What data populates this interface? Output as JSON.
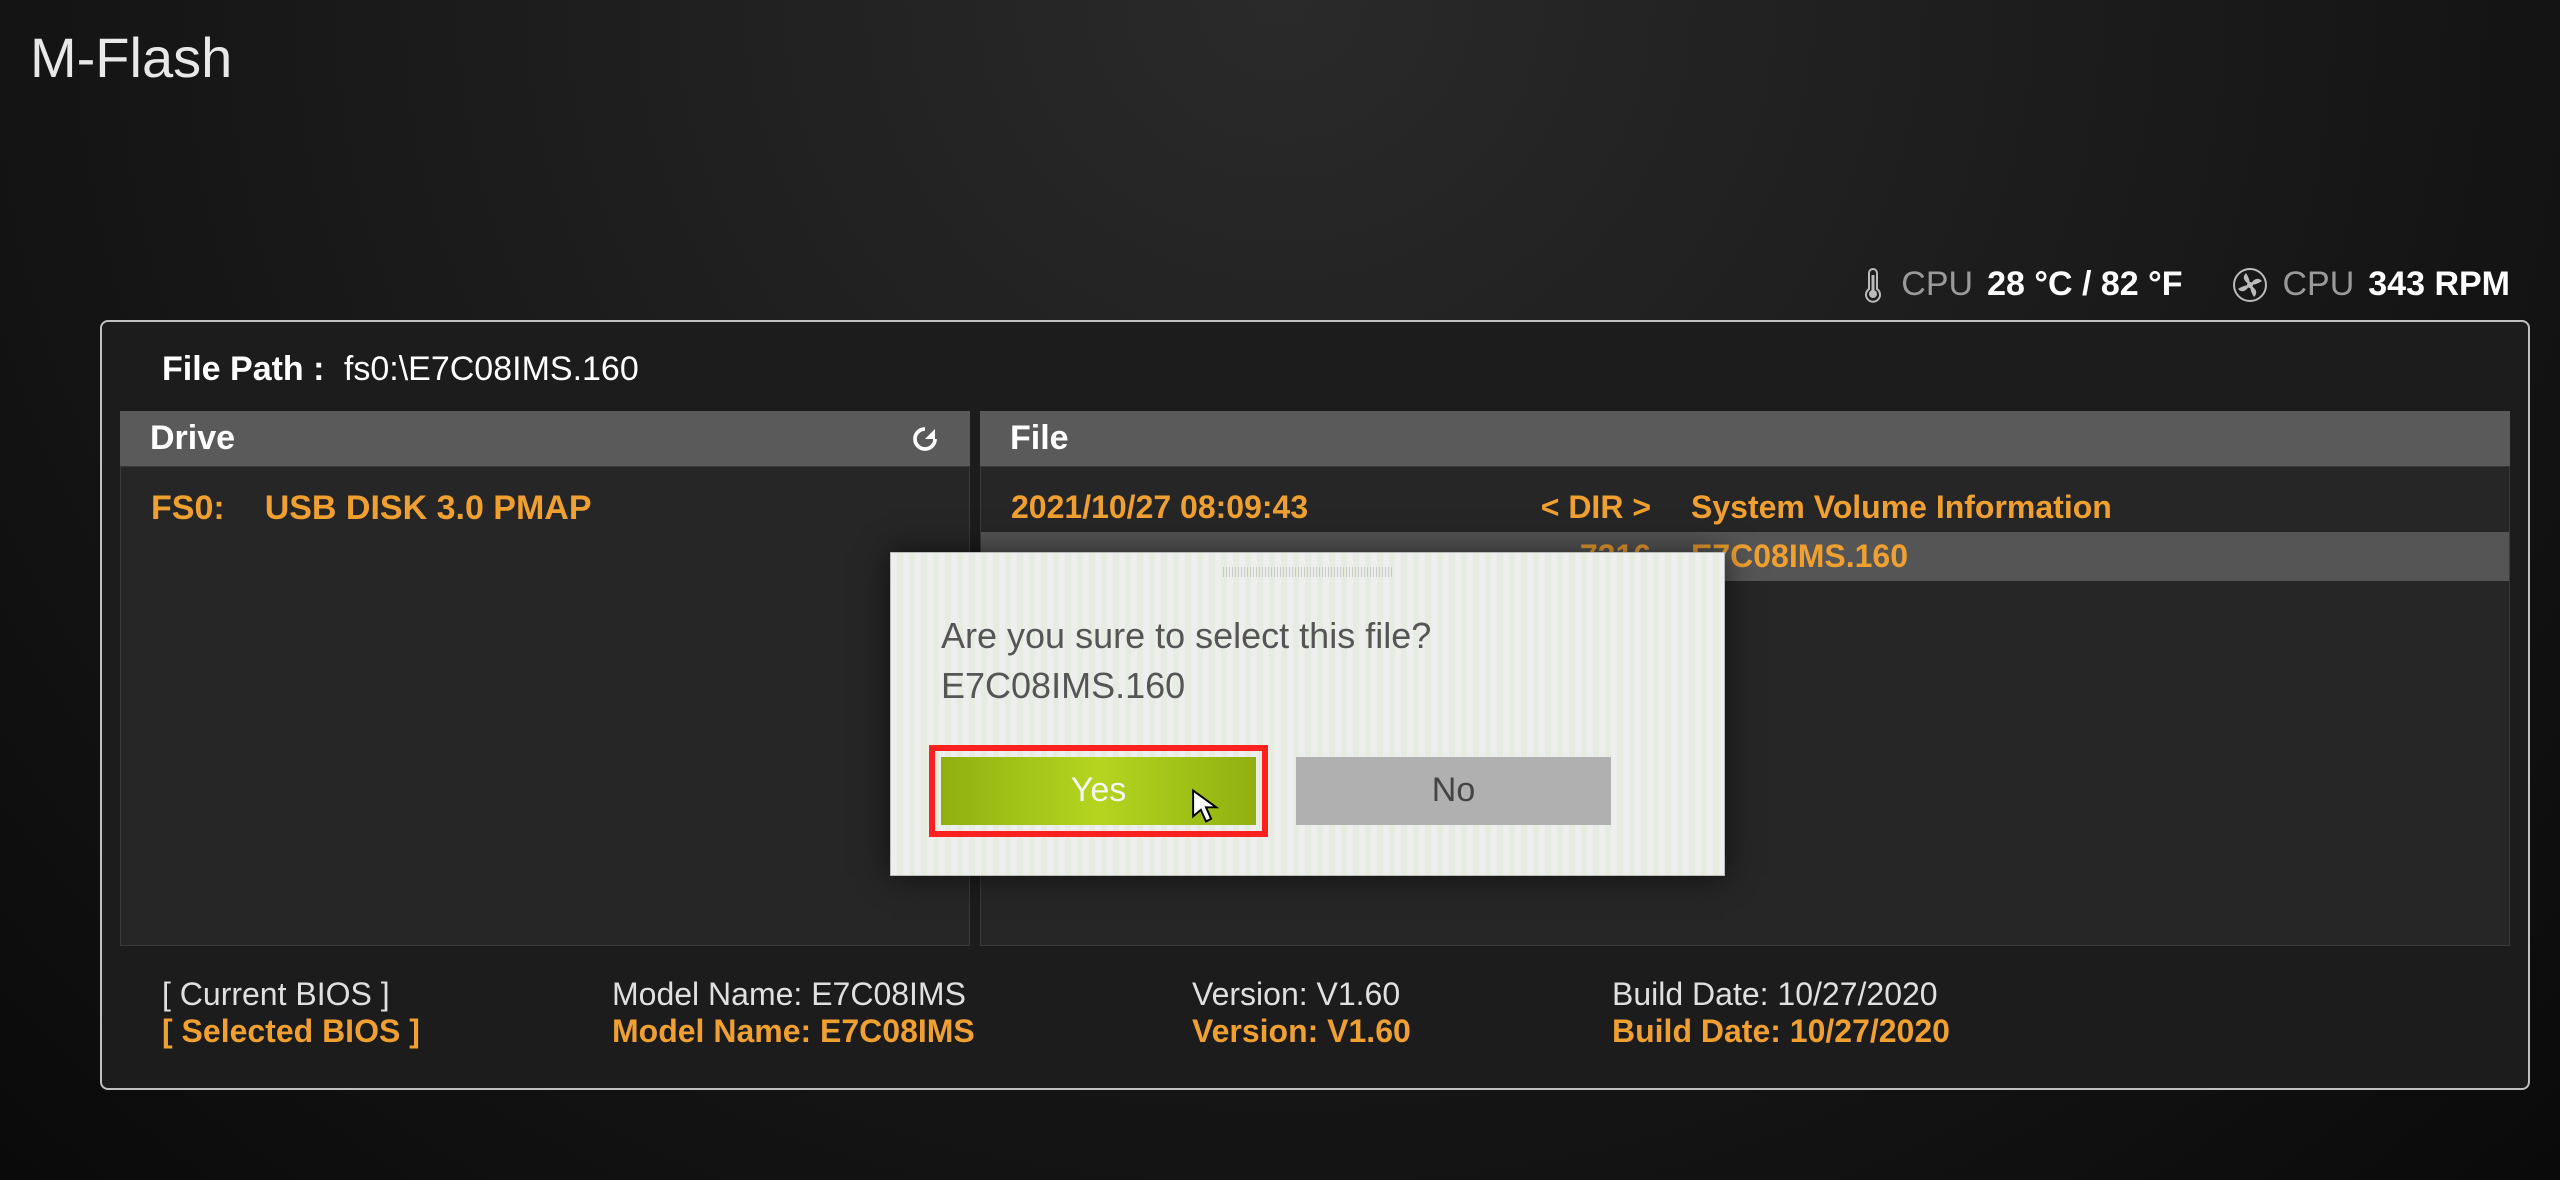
{
  "page_title": "M-Flash",
  "status": {
    "cpu_temp_label": "CPU",
    "cpu_temp_value": "28 °C / 82 °F",
    "cpu_fan_label": "CPU",
    "cpu_fan_value": "343 RPM"
  },
  "file_path": {
    "label": "File Path :",
    "value": "fs0:\\E7C08IMS.160"
  },
  "drive_header": "Drive",
  "file_header": "File",
  "drives": [
    {
      "id": "FS0:",
      "name": "USB DISK 3.0 PMAP"
    }
  ],
  "files": [
    {
      "date": "2021/10/27 08:09:43",
      "size": "< DIR >",
      "name": "System Volume Information",
      "is_dir": true
    },
    {
      "date": "",
      "size": "7216",
      "name": "E7C08IMS.160",
      "is_dir": false,
      "selected": true
    }
  ],
  "bios": {
    "current": {
      "label": "[ Current BIOS  ]",
      "model": "Model Name: E7C08IMS",
      "version": "Version: V1.60",
      "date": "Build Date: 10/27/2020"
    },
    "selected": {
      "label": "[ Selected BIOS ]",
      "model": "Model Name: E7C08IMS",
      "version": "Version: V1.60",
      "date": "Build Date: 10/27/2020"
    }
  },
  "dialog": {
    "line1": "Are you sure to select this file?",
    "line2": "E7C08IMS.160",
    "yes": "Yes",
    "no": "No"
  }
}
